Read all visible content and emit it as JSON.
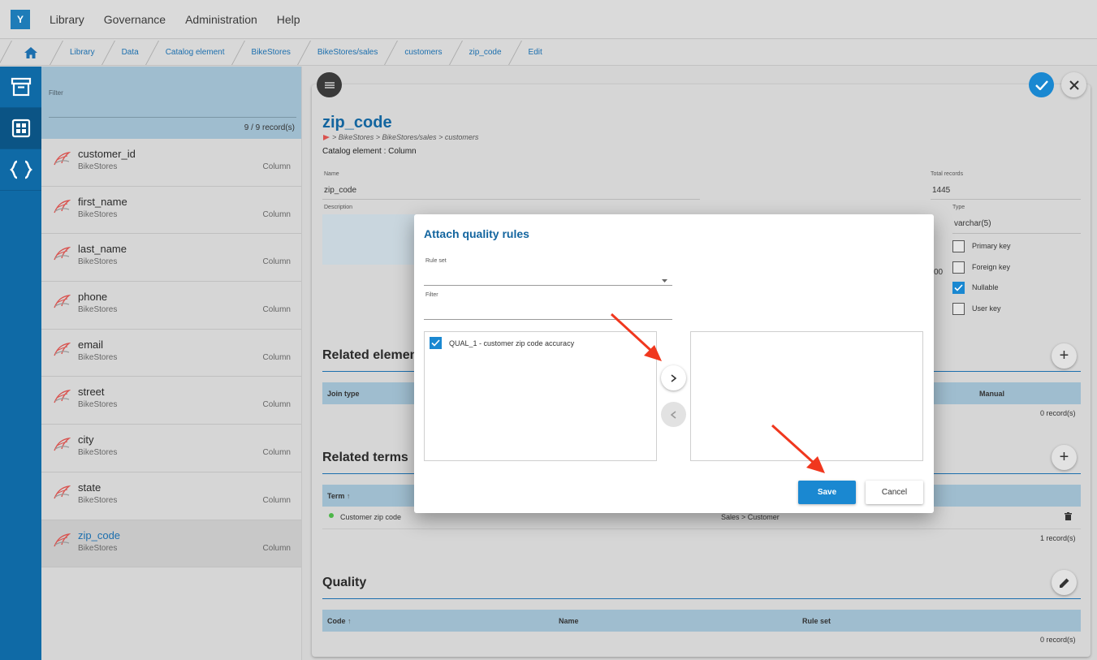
{
  "app": {
    "logo_letter": "Y"
  },
  "topmenu": [
    "Library",
    "Governance",
    "Administration",
    "Help"
  ],
  "breadcrumb": [
    "Library",
    "Data",
    "Catalog element",
    "BikeStores",
    "BikeStores/sales",
    "customers",
    "zip_code",
    "Edit"
  ],
  "list": {
    "filter_label": "Filter",
    "record_count": "9 / 9 record(s)",
    "items": [
      {
        "name": "customer_id",
        "sub": "BikeStores",
        "type": "Column"
      },
      {
        "name": "first_name",
        "sub": "BikeStores",
        "type": "Column"
      },
      {
        "name": "last_name",
        "sub": "BikeStores",
        "type": "Column"
      },
      {
        "name": "phone",
        "sub": "BikeStores",
        "type": "Column"
      },
      {
        "name": "email",
        "sub": "BikeStores",
        "type": "Column"
      },
      {
        "name": "street",
        "sub": "BikeStores",
        "type": "Column"
      },
      {
        "name": "city",
        "sub": "BikeStores",
        "type": "Column"
      },
      {
        "name": "state",
        "sub": "BikeStores",
        "type": "Column"
      },
      {
        "name": "zip_code",
        "sub": "BikeStores",
        "type": "Column"
      }
    ]
  },
  "detail": {
    "title": "zip_code",
    "path": "> BikeStores > BikeStores/sales > customers",
    "catalog_type": "Catalog element : Column",
    "name_label": "Name",
    "name_value": "zip_code",
    "total_records_label": "Total records",
    "total_records_value": "1445",
    "description_label": "Description",
    "type_label": "Type",
    "type_value": "varchar(5)",
    "partial_text": "00",
    "checkboxes": [
      {
        "label": "Primary key",
        "checked": false
      },
      {
        "label": "Foreign key",
        "checked": false
      },
      {
        "label": "Nullable",
        "checked": true
      },
      {
        "label": "User key",
        "checked": false
      }
    ],
    "related_elements": {
      "title": "Related elemen",
      "col_join": "Join type",
      "col_manual": "Manual",
      "count": "0 record(s)"
    },
    "related_terms": {
      "title": "Related terms",
      "col_term": "Term",
      "row_term": "Customer zip code",
      "row_path": "Sales  >  Customer",
      "count": "1 record(s)"
    },
    "quality": {
      "title": "Quality",
      "col_code": "Code",
      "col_name": "Name",
      "col_ruleset": "Rule set",
      "count": "0 record(s)"
    }
  },
  "dialog": {
    "title": "Attach quality rules",
    "ruleset_label": "Rule set",
    "filter_label": "Filter",
    "left_item": "QUAL_1 - customer zip code accuracy",
    "save_label": "Save",
    "cancel_label": "Cancel"
  },
  "colors": {
    "brand": "#1a88d1",
    "rail": "#0f6aa6",
    "annotation": "#f0371e"
  }
}
